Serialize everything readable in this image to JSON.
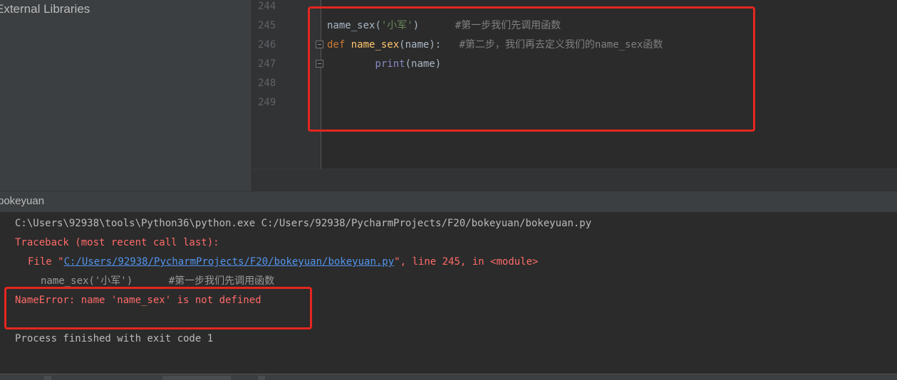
{
  "sidebar": {
    "item": "External Libraries"
  },
  "editor": {
    "lines": [
      {
        "num": "244"
      },
      {
        "num": "245",
        "call": "name_sex",
        "open": "(",
        "str": "'小军'",
        "close": ")",
        "comment": "#第一步我们先调用函数"
      },
      {
        "num": "246",
        "kw": "def",
        "fn": "name_sex",
        "params": "(name):",
        "comment": "#第二步，我们再去定义我们的name_sex函数"
      },
      {
        "num": "247",
        "builtin": "print",
        "args": "(name)"
      },
      {
        "num": "248"
      },
      {
        "num": "249"
      }
    ]
  },
  "run": {
    "title": "bokeyuan"
  },
  "console": {
    "cmd": "C:\\Users\\92938\\tools\\Python36\\python.exe C:/Users/92938/PycharmProjects/F20/bokeyuan/bokeyuan.py",
    "traceback": "Traceback (most recent call last):",
    "file_prefix": "File \"",
    "file_link": "C:/Users/92938/PycharmProjects/F20/bokeyuan/bokeyuan.py",
    "file_suffix": "\", line 245, in <module>",
    "source_line": "name_sex('小军')      #第一步我们先调用函数",
    "error": "NameError: name 'name_sex' is not defined",
    "exit": "Process finished with exit code 1"
  },
  "colors": {
    "highlight_box": "#e5261f",
    "error_text": "#ff6b68",
    "link": "#5394ec"
  }
}
